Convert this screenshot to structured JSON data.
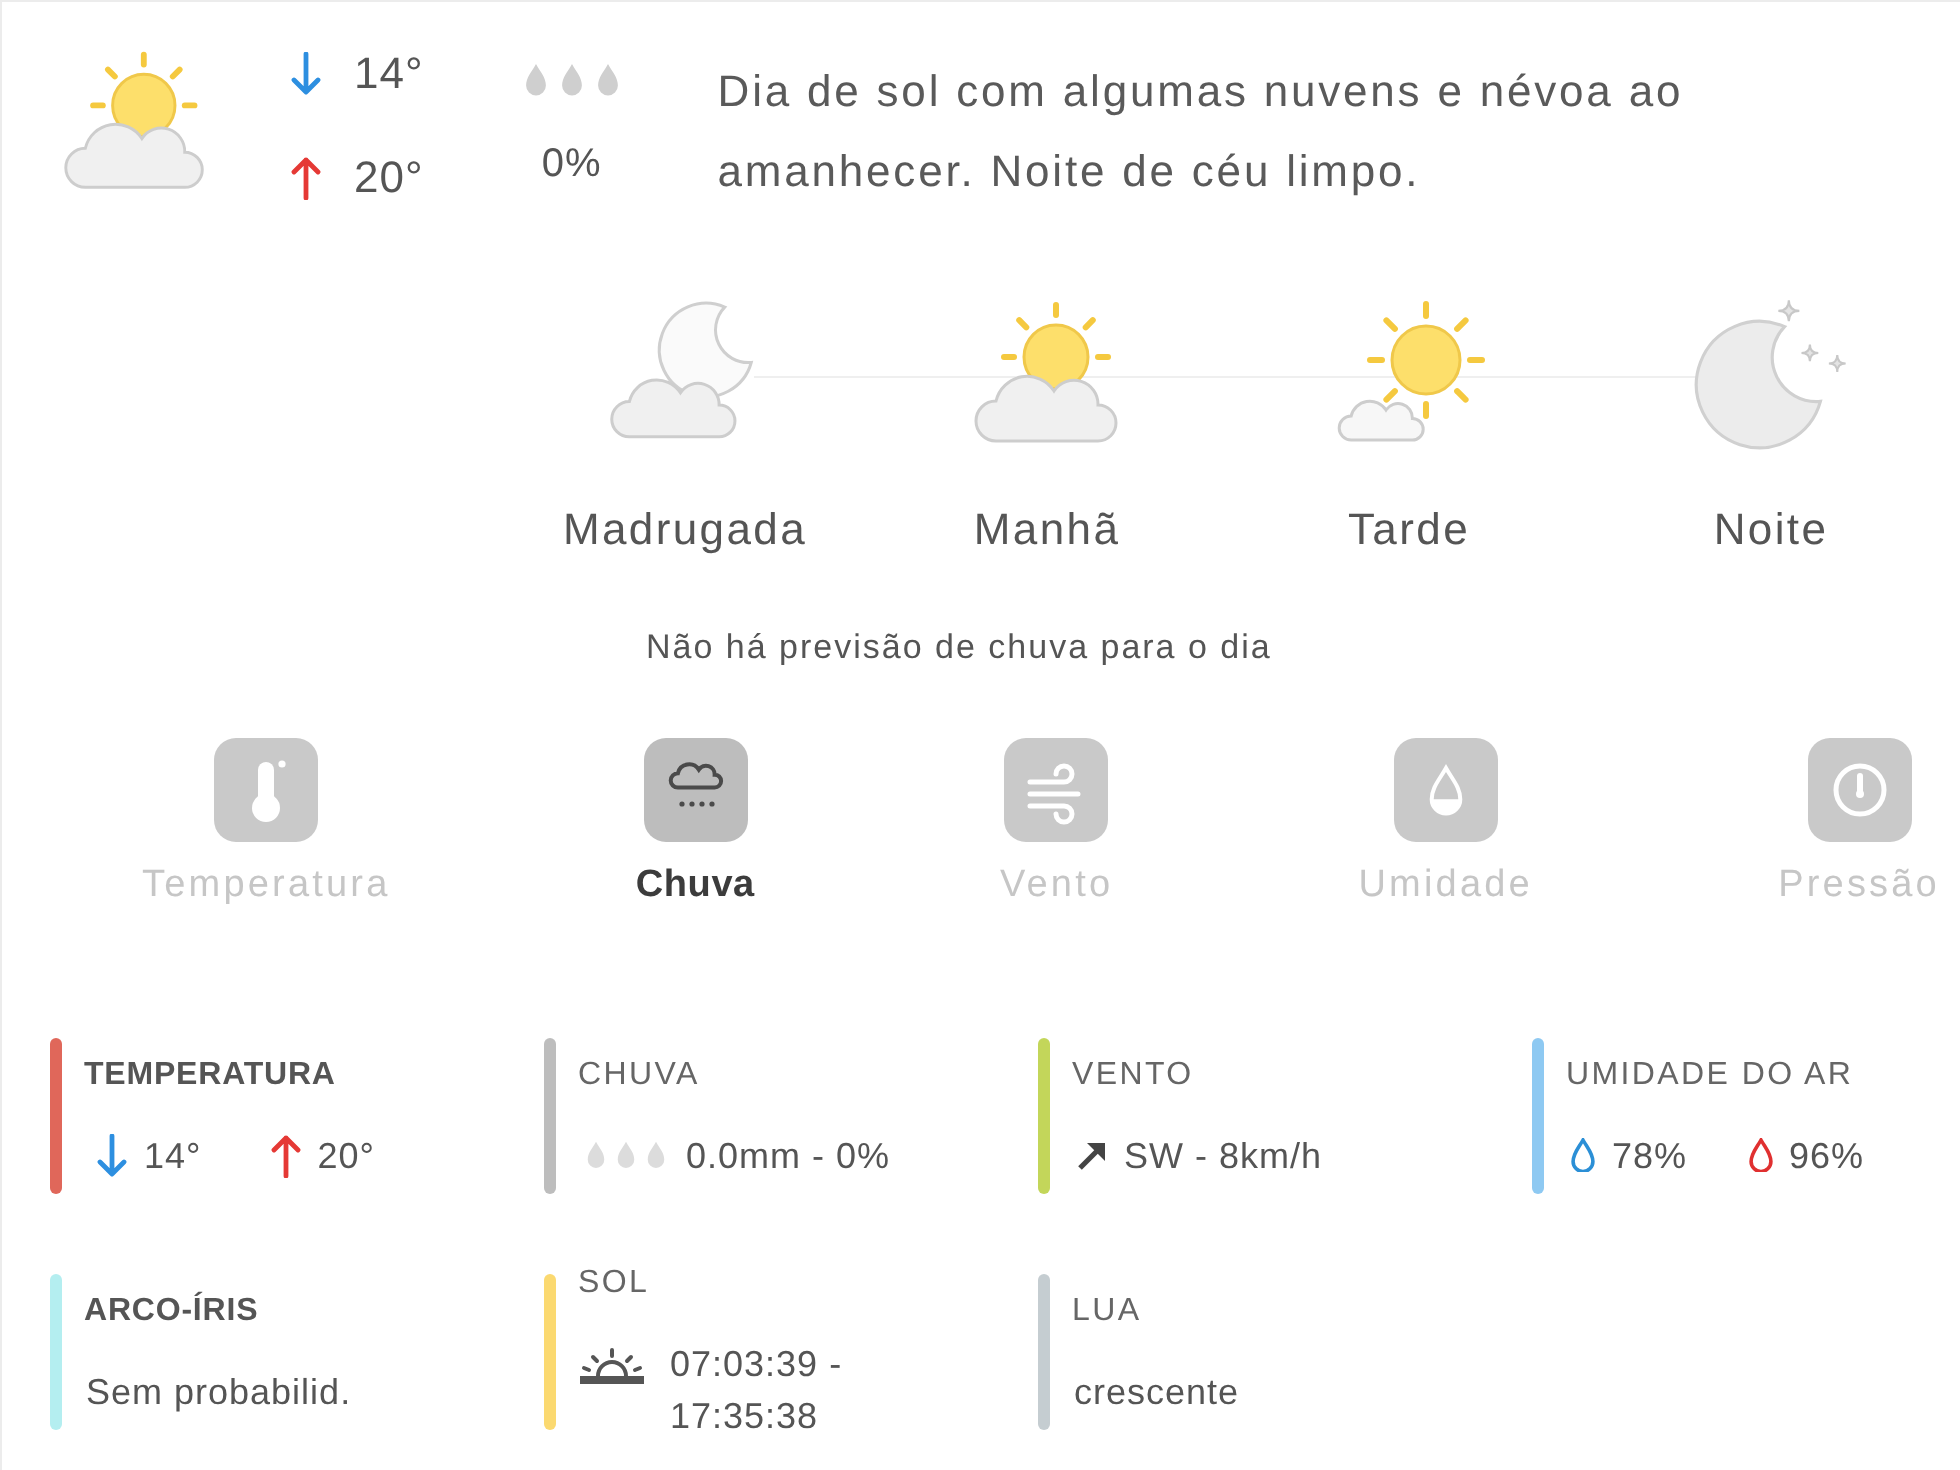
{
  "summary": {
    "kind": "partlycloudy",
    "min": "14°",
    "max": "20°",
    "rain_chance": "0%",
    "description": "Dia de sol com algumas nuvens e névoa ao amanhecer. Noite de céu limpo."
  },
  "periods": [
    {
      "label": "Madrugada",
      "kind": "cloudynight"
    },
    {
      "label": "Manhã",
      "kind": "partlycloudy"
    },
    {
      "label": "Tarde",
      "kind": "mostlysunny"
    },
    {
      "label": "Noite",
      "kind": "clearnight"
    }
  ],
  "rain_note": "Não há previsão de chuva para o dia",
  "tabs": [
    {
      "label": "Temperatura",
      "kind": "temperature",
      "selected": false
    },
    {
      "label": "Chuva",
      "kind": "rain",
      "selected": true
    },
    {
      "label": "Vento",
      "kind": "wind",
      "selected": false
    },
    {
      "label": "Umidade",
      "kind": "humidity",
      "selected": false
    },
    {
      "label": "Pressão",
      "kind": "pressure",
      "selected": false
    }
  ],
  "cards": [
    {
      "title": "TEMPERATURA",
      "kind": "temperature",
      "color": "#e0675a",
      "bold": true,
      "min": "14°",
      "max": "20°"
    },
    {
      "title": "CHUVA",
      "kind": "rain",
      "color": "#bdbdbd",
      "bold": false,
      "value": "0.0mm - 0%"
    },
    {
      "title": "VENTO",
      "kind": "wind",
      "color": "#c3d65a",
      "bold": false,
      "value": "SW - 8km/h"
    },
    {
      "title": "UMIDADE DO AR",
      "kind": "humidity",
      "color": "#8ec9f2",
      "bold": false,
      "min": "78%",
      "max": "96%"
    },
    {
      "title": "ARCO-ÍRIS",
      "kind": "text",
      "color": "#b4eef0",
      "bold": true,
      "value": "Sem probabilid."
    },
    {
      "title": "SOL",
      "kind": "sun",
      "color": "#fbd970",
      "bold": false,
      "value": "07:03:39 - 17:35:38"
    },
    {
      "title": "LUA",
      "kind": "text",
      "color": "#c5cdd1",
      "bold": false,
      "value": "crescente"
    }
  ]
}
